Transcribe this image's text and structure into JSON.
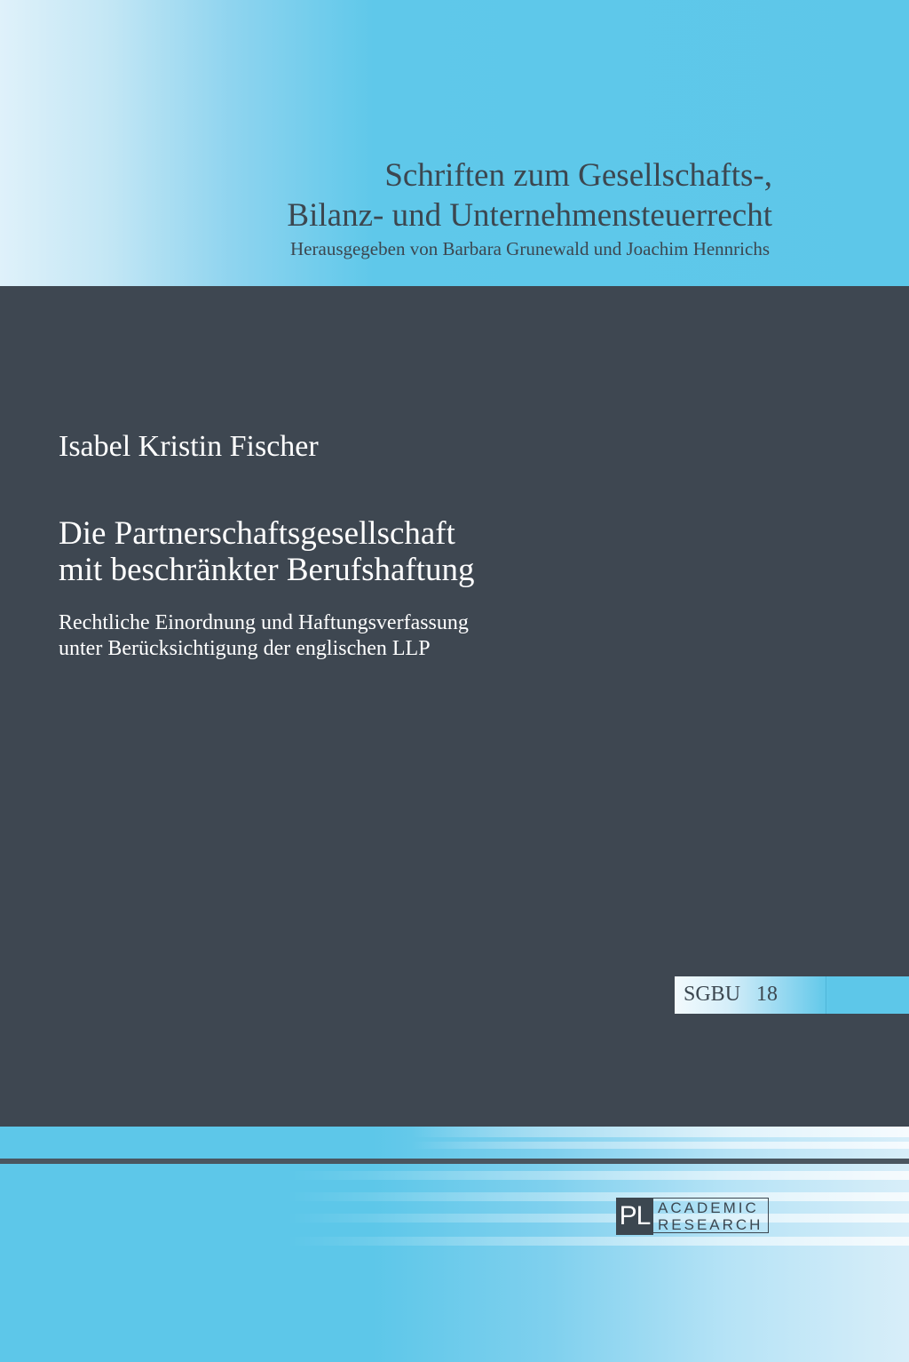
{
  "series": {
    "title_lines": [
      "Schriften zum Gesellschafts-,",
      "Bilanz- und Unternehmensteuerrecht"
    ],
    "editors": "Herausgegeben von Barbara Grunewald und Joachim Hennrichs",
    "abbreviation": "SGBU",
    "volume": "18"
  },
  "book": {
    "author": "Isabel Kristin Fischer",
    "title_lines": [
      "Die Partnerschaftsgesellschaft",
      "mit beschränkter Berufshaftung"
    ],
    "subtitle_lines": [
      "Rechtliche Einordnung und Haftungsverfassung",
      "unter Berücksichtigung der englischen LLP"
    ]
  },
  "publisher": {
    "mark": "PL",
    "name_lines": [
      "ACADEMIC",
      "RESEARCH"
    ]
  },
  "colors": {
    "accent_blue": "#5dc7e9",
    "dark_panel": "#3e4751",
    "text_dark": "#3c4750",
    "text_light": "#ffffff"
  }
}
